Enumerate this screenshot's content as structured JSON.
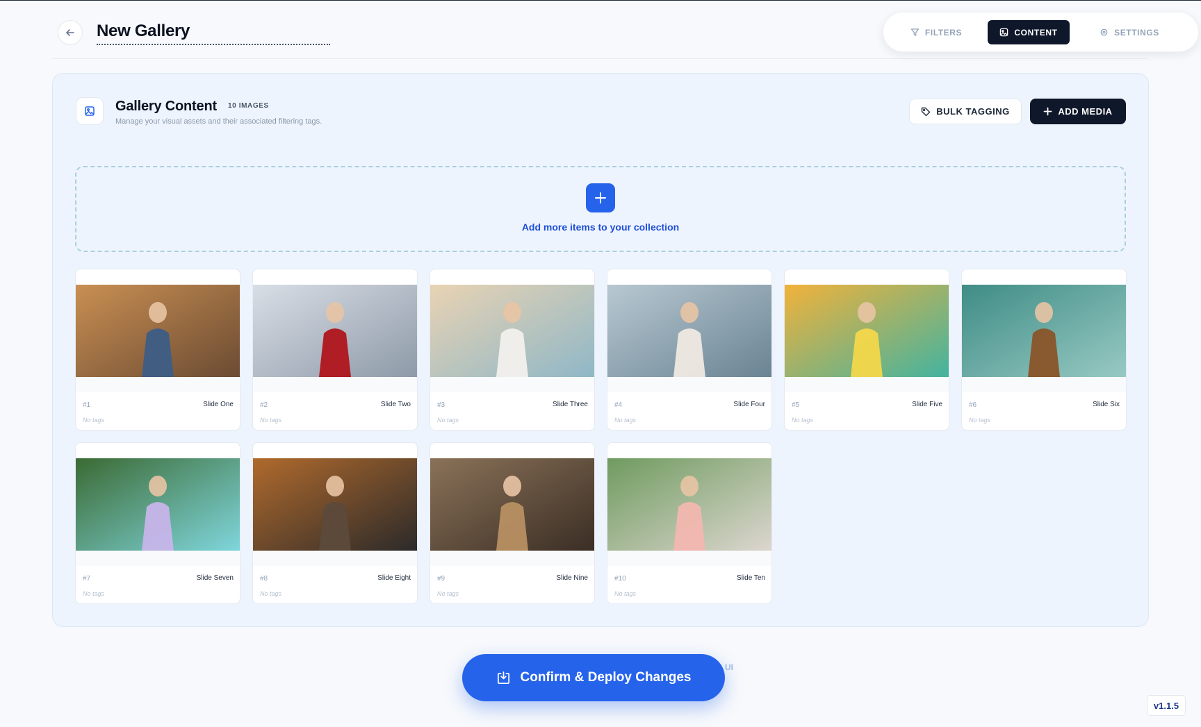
{
  "header": {
    "back_icon": "arrow-left-icon",
    "title": "New Gallery",
    "tabs": [
      {
        "label": "FILTERS",
        "icon": "filter-icon",
        "active": false
      },
      {
        "label": "CONTENT",
        "icon": "image-icon",
        "active": true
      },
      {
        "label": "SETTINGS",
        "icon": "gear-icon",
        "active": false
      }
    ]
  },
  "panel": {
    "title": "Gallery Content",
    "count": "10 IMAGES",
    "subtitle": "Manage your visual assets and their associated filtering tags.",
    "bulk_label": "BULK TAGGING",
    "add_label": "ADD MEDIA",
    "dropzone_label": "Add more items to your collection"
  },
  "cards": [
    {
      "index": "#1",
      "name": "Slide One",
      "tags": "No tags"
    },
    {
      "index": "#2",
      "name": "Slide Two",
      "tags": "No tags"
    },
    {
      "index": "#3",
      "name": "Slide Three",
      "tags": "No tags"
    },
    {
      "index": "#4",
      "name": "Slide Four",
      "tags": "No tags"
    },
    {
      "index": "#5",
      "name": "Slide Five",
      "tags": "No tags"
    },
    {
      "index": "#6",
      "name": "Slide Six",
      "tags": "No tags"
    },
    {
      "index": "#7",
      "name": "Slide Seven",
      "tags": "No tags"
    },
    {
      "index": "#8",
      "name": "Slide Eight",
      "tags": "No tags"
    },
    {
      "index": "#9",
      "name": "Slide Nine",
      "tags": "No tags"
    },
    {
      "index": "#10",
      "name": "Slide Ten",
      "tags": "No tags"
    }
  ],
  "footer": {
    "deploy_label": "Confirm & Deploy Changes",
    "peek_text": "UI",
    "version": "v1.1.5"
  },
  "colors": {
    "accent": "#2563eb",
    "dark": "#0f172a",
    "panel_bg": "#eef4fd"
  }
}
